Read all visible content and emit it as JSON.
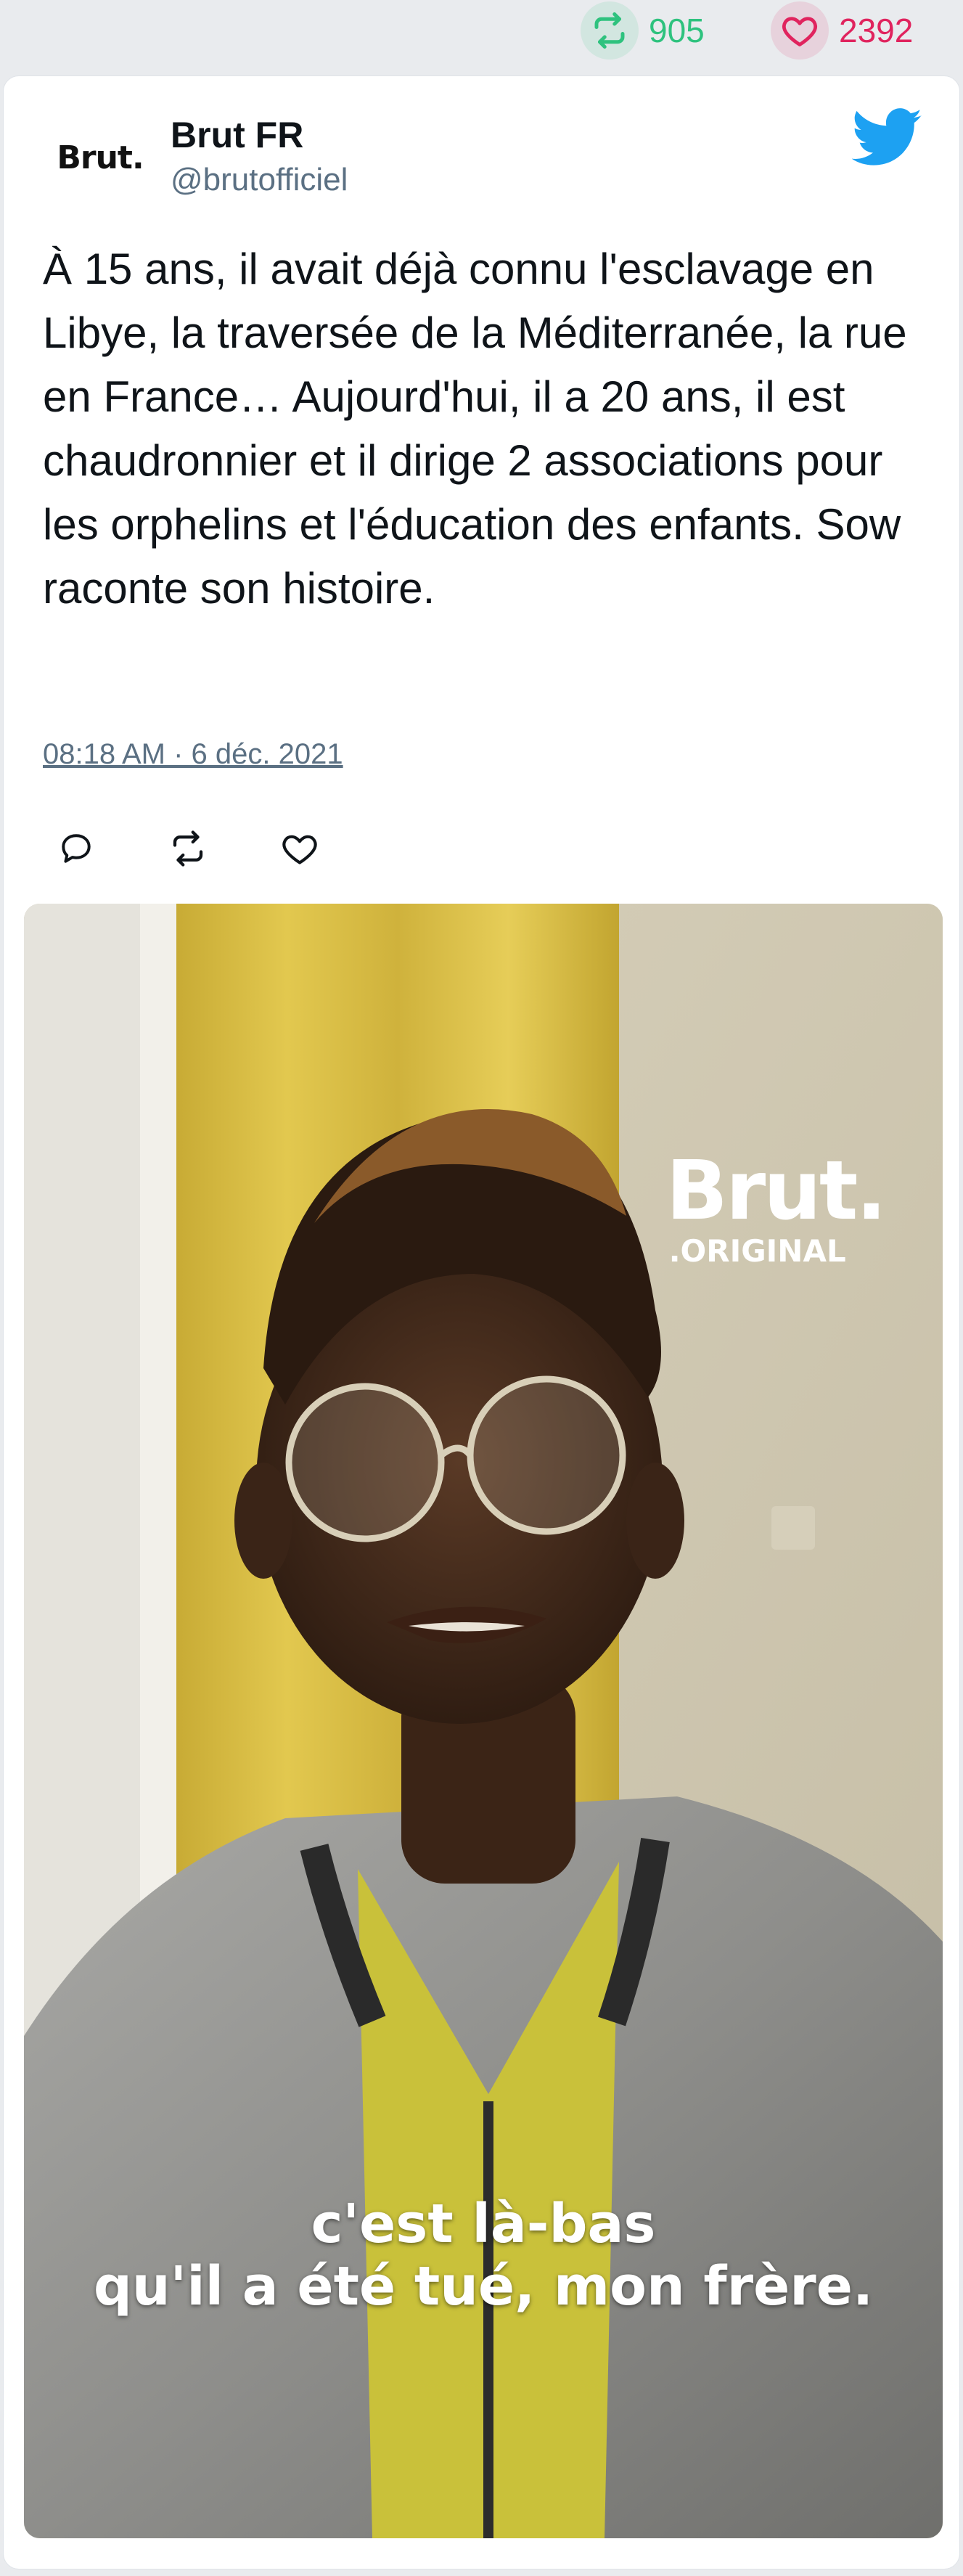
{
  "stats": {
    "retweets": "905",
    "likes": "2392",
    "retweet_icon": "retweet-icon",
    "like_icon": "heart-icon",
    "retweet_color": "#2ec27e",
    "like_color": "#e0245e"
  },
  "author": {
    "avatar_text": "Brut.",
    "display_name": "Brut FR",
    "handle": "@brutofficiel"
  },
  "brand": {
    "icon": "twitter-bird-icon",
    "color": "#1da1f2"
  },
  "tweet": {
    "text": "À 15 ans, il avait déjà connu l'esclavage en Libye, la traversée de la Méditerranée, la rue en France… Aujourd'hui, il a 20 ans, il est chaudronnier et il dirige 2 associations pour les orphelins et l'éducation des enfants. Sow raconte son histoire.",
    "timestamp": "08:18 AM · 6 déc. 2021"
  },
  "actions": [
    "reply-icon",
    "retweet-icon",
    "like-icon"
  ],
  "media": {
    "watermark_main": "Brut.",
    "watermark_sub": ".ORIGINAL",
    "subtitle_line1": "c'est là-bas",
    "subtitle_line2": "qu'il a été tué, mon frère."
  }
}
